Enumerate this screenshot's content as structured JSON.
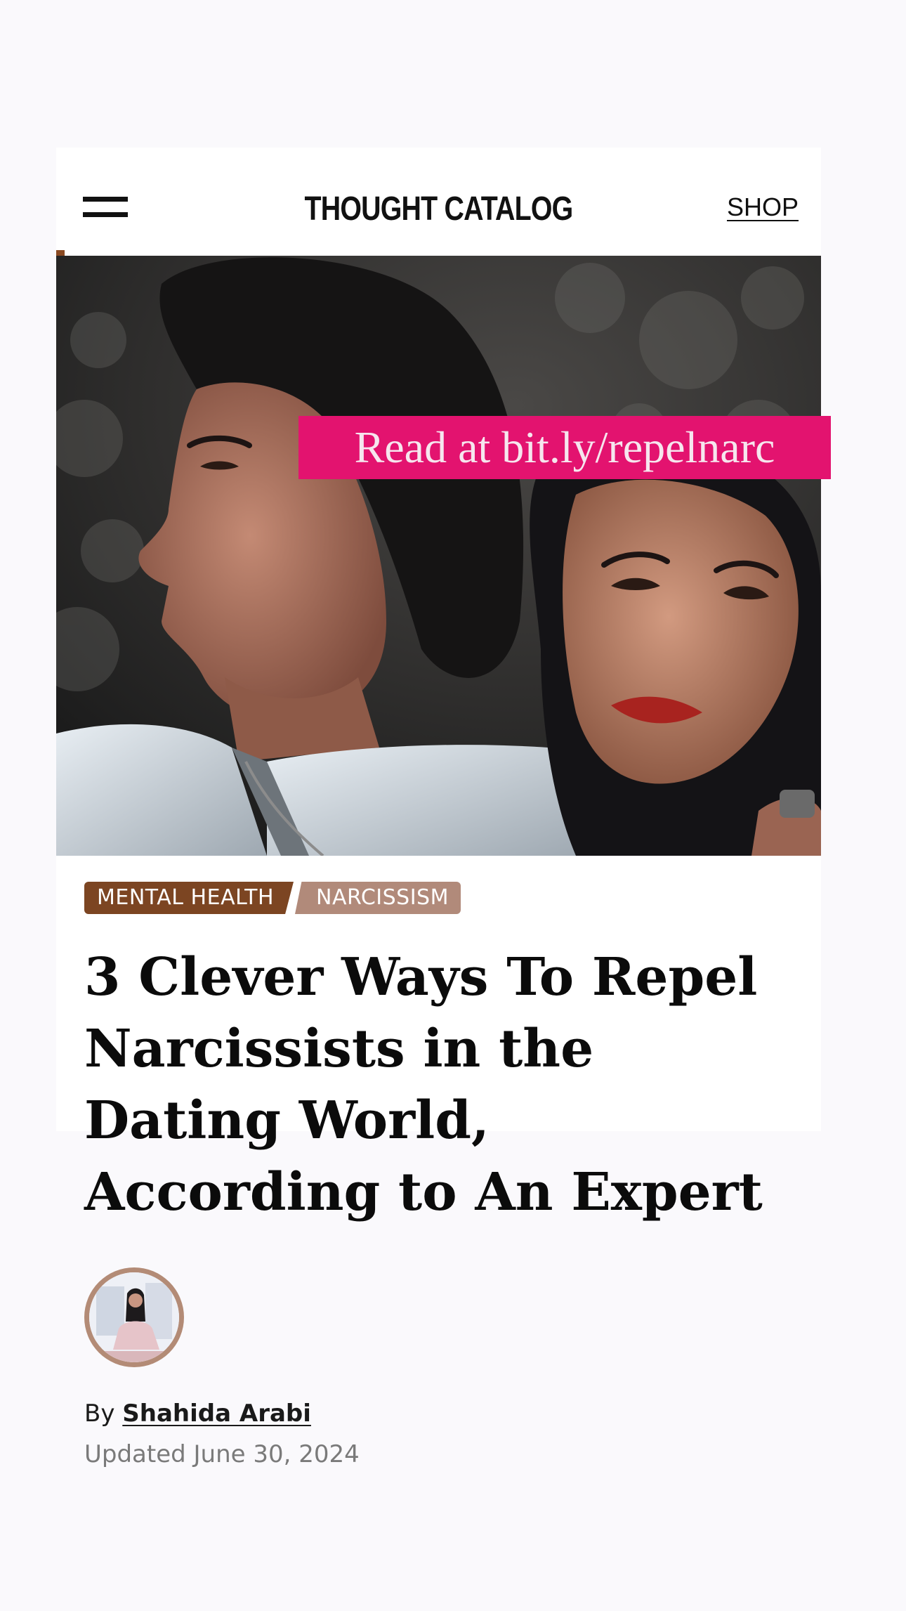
{
  "header": {
    "brand": "THOUGHT CATALOG",
    "shop_label": "SHOP"
  },
  "hero": {
    "banner_text": "Read at bit.ly/repelnarc"
  },
  "article": {
    "tags": [
      "MENTAL HEALTH",
      "NARCISSISM"
    ],
    "title": "3 Clever Ways To Repel Narcissists in the Dating World, According to An Expert",
    "byline_prefix": "By",
    "author": "Shahida Arabi",
    "updated": "Updated June 30, 2024"
  },
  "colors": {
    "promo_pink": "#e3136f",
    "tag_primary": "#7c4522",
    "tag_secondary": "#b18a7a",
    "avatar_ring": "#b38b76"
  },
  "icons": {
    "menu": "menu-icon",
    "avatar": "author-avatar"
  }
}
